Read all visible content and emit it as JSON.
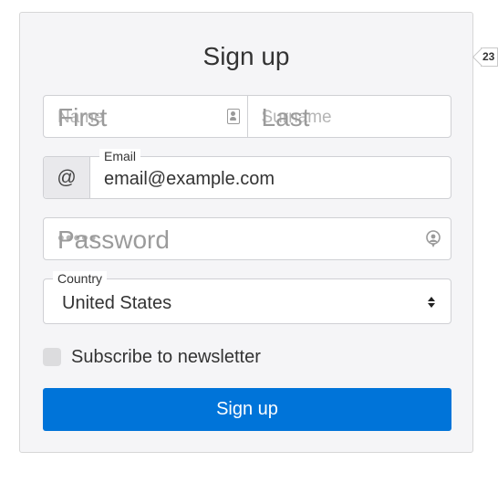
{
  "form": {
    "title": "Sign up",
    "first_name": {
      "label": "First",
      "placeholder": "Name"
    },
    "last_name": {
      "label": "Last",
      "placeholder": "Surname"
    },
    "email": {
      "addon": "@",
      "label": "Email",
      "value": "email@example.com"
    },
    "password": {
      "label": "Password",
      "placeholder": "•••••"
    },
    "country": {
      "label": "Country",
      "value": "United States"
    },
    "newsletter": {
      "label": "Subscribe to newsletter",
      "checked": false
    },
    "submit_label": "Sign up"
  },
  "side_tag": {
    "text": "23"
  },
  "colors": {
    "primary": "#0074d9",
    "card_bg": "#f5f5f7"
  },
  "icons": [
    "contact-card-icon",
    "password-reveal-icon",
    "sort-arrows-icon"
  ]
}
